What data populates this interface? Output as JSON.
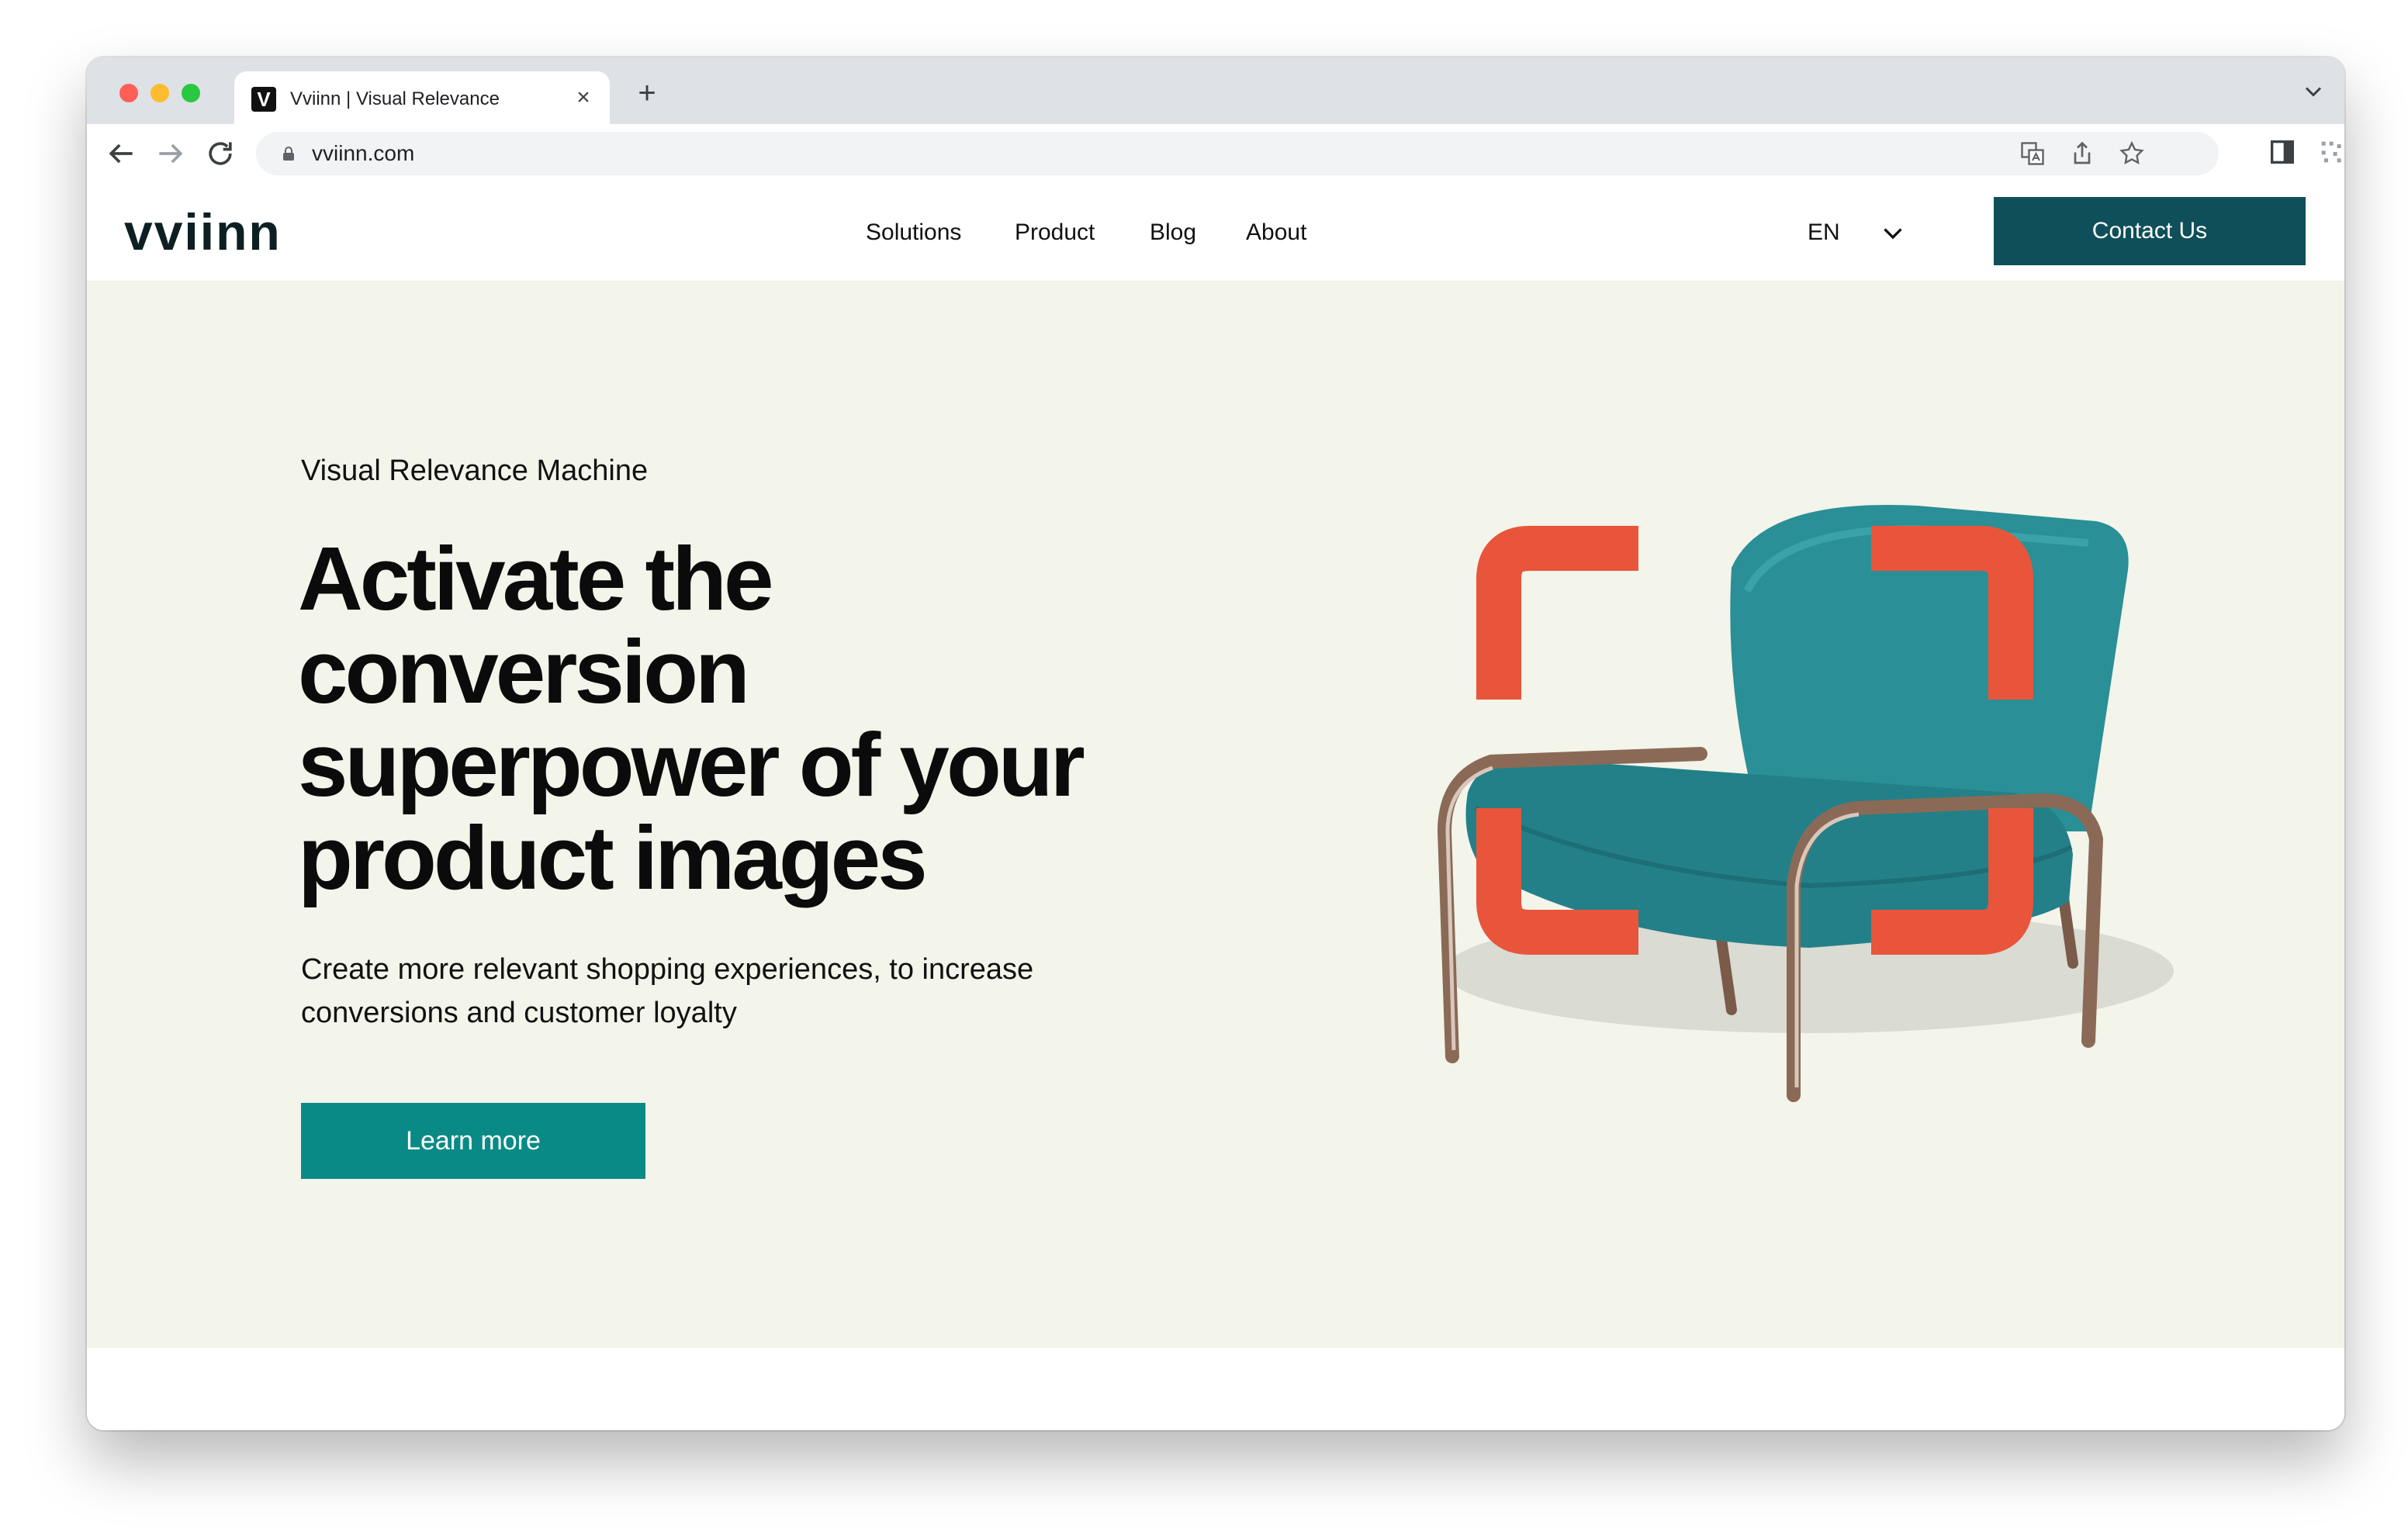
{
  "browser": {
    "tab_title": "Vviinn | Visual Relevance",
    "favicon_letter": "V",
    "tab_close": "×",
    "new_tab": "+",
    "url": "vviinn.com"
  },
  "site": {
    "logo_text": "vviinn",
    "nav": [
      "Solutions",
      "Product",
      "Blog",
      "About"
    ],
    "language": "EN",
    "contact_label": "Contact Us"
  },
  "hero": {
    "eyebrow": "Visual Relevance Machine",
    "headline": "Activate the conversion superpower of your product images",
    "subtext": "Create more relevant shopping experiences, to increase conversions and customer loyalty",
    "cta_label": "Learn more"
  },
  "colors": {
    "brand_dark": "#0f4f59",
    "cta_teal": "#0a8a86",
    "hero_bg": "#f3f4ea",
    "accent_orange": "#e9553b",
    "chair_teal": "#2a8f96"
  },
  "icons": [
    "back-icon",
    "forward-icon",
    "reload-icon",
    "lock-icon",
    "translate-icon",
    "share-icon",
    "bookmark-star-icon",
    "side-panel-icon",
    "extension-icon",
    "menu-dots-icon",
    "chevron-down-icon"
  ]
}
